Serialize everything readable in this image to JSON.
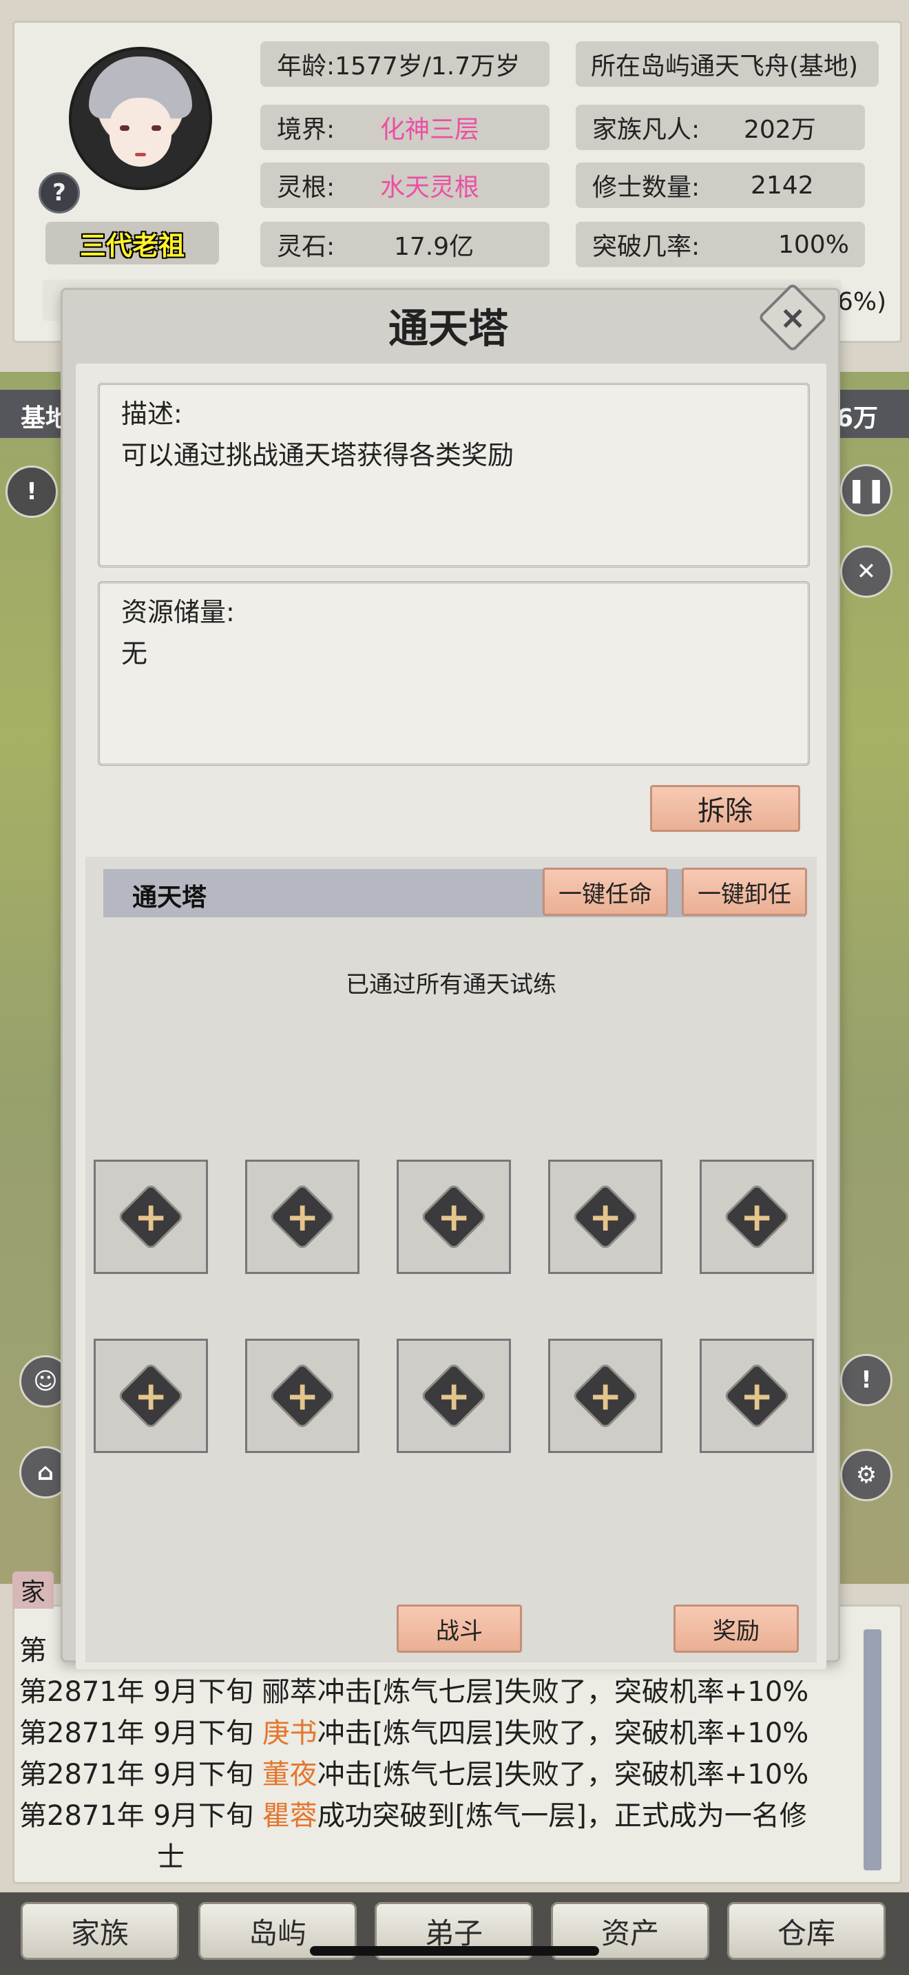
{
  "profile": {
    "title": "三代老祖",
    "help_symbol": "?"
  },
  "stats_left": [
    {
      "label": "年龄:",
      "value": "1577岁/1.7万岁"
    },
    {
      "label": "境界:",
      "value": "化神三层"
    },
    {
      "label": "灵根:",
      "value": "水天灵根"
    },
    {
      "label": "灵石:",
      "value": "17.9亿"
    }
  ],
  "stats_right": [
    {
      "label": "所在岛屿",
      "value": "通天飞舟(基地)"
    },
    {
      "label": "家族凡人:",
      "value": "202万"
    },
    {
      "label": "修士数量:",
      "value": "2142"
    },
    {
      "label": "突破几率:",
      "value": "100%"
    }
  ],
  "background": {
    "partial_right_text": "6%)",
    "map_bar_left": "基地",
    "map_bar_right": "6万",
    "log_tab_partial": "家"
  },
  "modal": {
    "title": "通天塔",
    "close_symbol": "×",
    "description_label": "描述:",
    "description_text": "可以通过挑战通天塔获得各类奖励",
    "resource_label": "资源储量:",
    "resource_text": "无",
    "demolish_label": "拆除",
    "section_title": "通天塔",
    "appoint_all_label": "一键任命",
    "dismiss_all_label": "一键卸任",
    "status_text": "已通过所有通天试练",
    "slot_symbol": "+",
    "battle_label": "战斗",
    "reward_label": "奖励"
  },
  "log": {
    "partial_first": "第",
    "partial_second": "第2871年 9月下旬 郦萃冲击[炼气七层]失败了，突破机率+10%",
    "lines": [
      {
        "prefix": "第2871年 9月下旬 ",
        "name": "庚书",
        "text": "冲击[炼气四层]失败了，突破机率+10%"
      },
      {
        "prefix": "第2871年 9月下旬 ",
        "name": "董夜",
        "text": "冲击[炼气七层]失败了，突破机率+10%"
      },
      {
        "prefix": "第2871年 9月下旬 ",
        "name": "瞿蓉",
        "text": "成功突破到[炼气一层]，正式成为一名修"
      }
    ],
    "wrap": "士"
  },
  "nav": [
    "家族",
    "岛屿",
    "弟子",
    "资产",
    "仓库"
  ],
  "colors": {
    "realm_pink": "#ec4fa3",
    "name_orange": "#e4762d",
    "title_yellow": "#fff22a",
    "button_peach": "#f2bca2"
  }
}
